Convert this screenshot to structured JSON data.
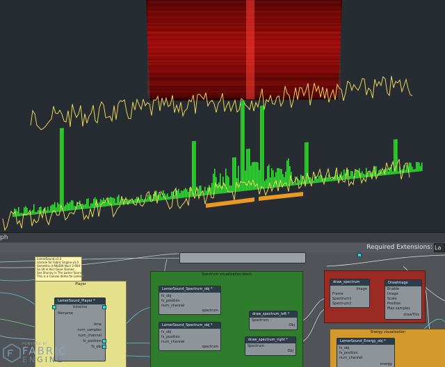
{
  "graph_panel": {
    "title": "ph",
    "required_extensions_label": "Required Extensions:",
    "extensions_value": "La"
  },
  "sticky_note": {
    "lines": [
      "LamerSound.v1.0",
      "Librarie for Fabric Engine v1.0",
      "Somethin d AKoDiK Nucr 2-084",
      "Sa 19 el Avcl Gene iSamee",
      "See Shunny in The Lamer Sound",
      "This is a Canvas demo for Lamer Sound"
    ]
  },
  "backdrops": {
    "player": "Player",
    "spectrum_viz": "Spectrum visualization block",
    "energy_viz": "Energy visualization"
  },
  "nodes": {
    "player": {
      "title": "LamerSound_Player *",
      "ports": [
        "timeline",
        "filename",
        "time",
        "num_samples",
        "num_channel",
        "fs_position",
        "fs_obj"
      ]
    },
    "spectrum_obj_1": {
      "title": "LamerSound_Spectrum_obj *",
      "ports": [
        "fs_obj",
        "fs_position",
        "num_channel",
        "spectrum"
      ]
    },
    "spectrum_obj_2": {
      "title": "LamerSound_Spectrum_obj *",
      "ports": [
        "fs_obj",
        "fs_position",
        "num_channel",
        "spectrum"
      ]
    },
    "draw_left": {
      "title": "draw_spectrum_left *",
      "ports": [
        "Spectrum",
        "Obj"
      ]
    },
    "draw_right": {
      "title": "draw_spectrum_right *",
      "ports": [
        "Spectrum",
        "Obj"
      ]
    },
    "draw_spectrum": {
      "title": "draw_spectrum",
      "ports": [
        "Frame",
        "Spectrum1",
        "Spectrum2",
        "Image"
      ]
    },
    "draw_image": {
      "title": "DrawImage",
      "ports": [
        "Enable",
        "Image",
        "Scale",
        "Position",
        "Max samples",
        "drawThis"
      ]
    },
    "energy_obj": {
      "title": "LamerSound_Energy_obj *",
      "ports": [
        "fs_obj",
        "fs_position",
        "num_channel",
        "energy"
      ]
    }
  },
  "logo": {
    "small_text": "POWERED BY",
    "word1": "FABRIC",
    "word2": "ENGINE"
  },
  "colors": {
    "viewport_bg": "#262c31",
    "spectrum_bars": "#2ee62e",
    "waveform": "#e8d85a",
    "spectrogram": "#ff2020",
    "marker_bars": "#e89a22",
    "backdrop_player": "#e5e08c",
    "backdrop_spectrum": "#2f7d2c",
    "backdrop_draw": "#9a2a22",
    "backdrop_energy": "#d29a2c",
    "pin": "#3ccfd6"
  }
}
